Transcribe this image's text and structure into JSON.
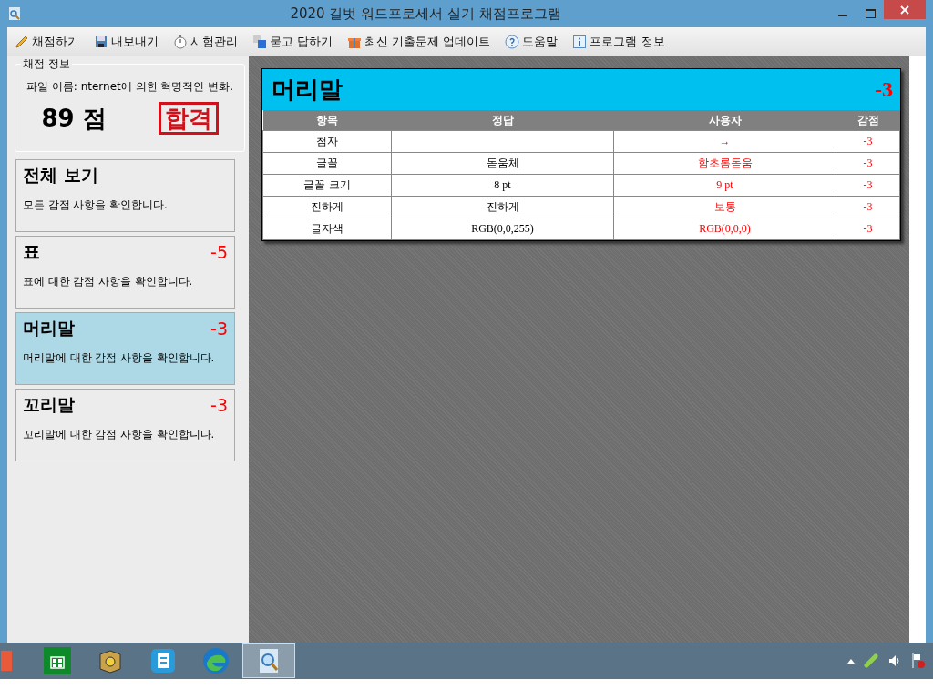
{
  "window": {
    "title": "2020 길벗 워드프로세서 실기 채점프로그램"
  },
  "toolbar": [
    {
      "label": "채점하기"
    },
    {
      "label": "내보내기"
    },
    {
      "label": "시험관리"
    },
    {
      "label": "묻고 답하기"
    },
    {
      "label": "최신 기출문제 업데이트"
    },
    {
      "label": "도움말"
    },
    {
      "label": "프로그램 정보"
    }
  ],
  "grading_info": {
    "title": "채점 정보",
    "file_name": "파일 이름: nternet에 의한 혁명적인 변화.",
    "score": "89 점",
    "stamp": "합격"
  },
  "categories": [
    {
      "title": "전체 보기",
      "description": "모든 감점 사항을 확인합니다.",
      "selected": false
    },
    {
      "title": "표",
      "deduction": "-5",
      "description": "표에 대한 감점 사항을 확인합니다.",
      "selected": false
    },
    {
      "title": "머리말",
      "deduction": "-3",
      "description": "머리말에 대한 감점 사항을 확인합니다.",
      "selected": true
    },
    {
      "title": "꼬리말",
      "deduction": "-3",
      "description": "꼬리말에 대한 감점 사항을 확인합니다.",
      "selected": false
    }
  ],
  "detail": {
    "title": "머리말",
    "deduction": "-3",
    "columns": [
      "항목",
      "정답",
      "사용자",
      "감점"
    ],
    "rows": [
      {
        "item": "첨자",
        "answer": "",
        "user": "→",
        "deduction": "-3"
      },
      {
        "item": "글꼴",
        "answer": "돋움체",
        "user": "함초롬돋움",
        "deduction": "-3"
      },
      {
        "item": "글꼴 크기",
        "answer": "8 pt",
        "user": "9 pt",
        "deduction": "-3"
      },
      {
        "item": "진하게",
        "answer": "진하게",
        "user": "보통",
        "deduction": "-3"
      },
      {
        "item": "글자색",
        "answer": "RGB(0,0,255)",
        "user": "RGB(0,0,0)",
        "deduction": "-3"
      }
    ]
  },
  "taskbar": {
    "apps": [
      {
        "selected": false
      },
      {
        "selected": false
      },
      {
        "selected": false
      },
      {
        "selected": false
      },
      {
        "selected": false
      },
      {
        "selected": true
      }
    ]
  }
}
